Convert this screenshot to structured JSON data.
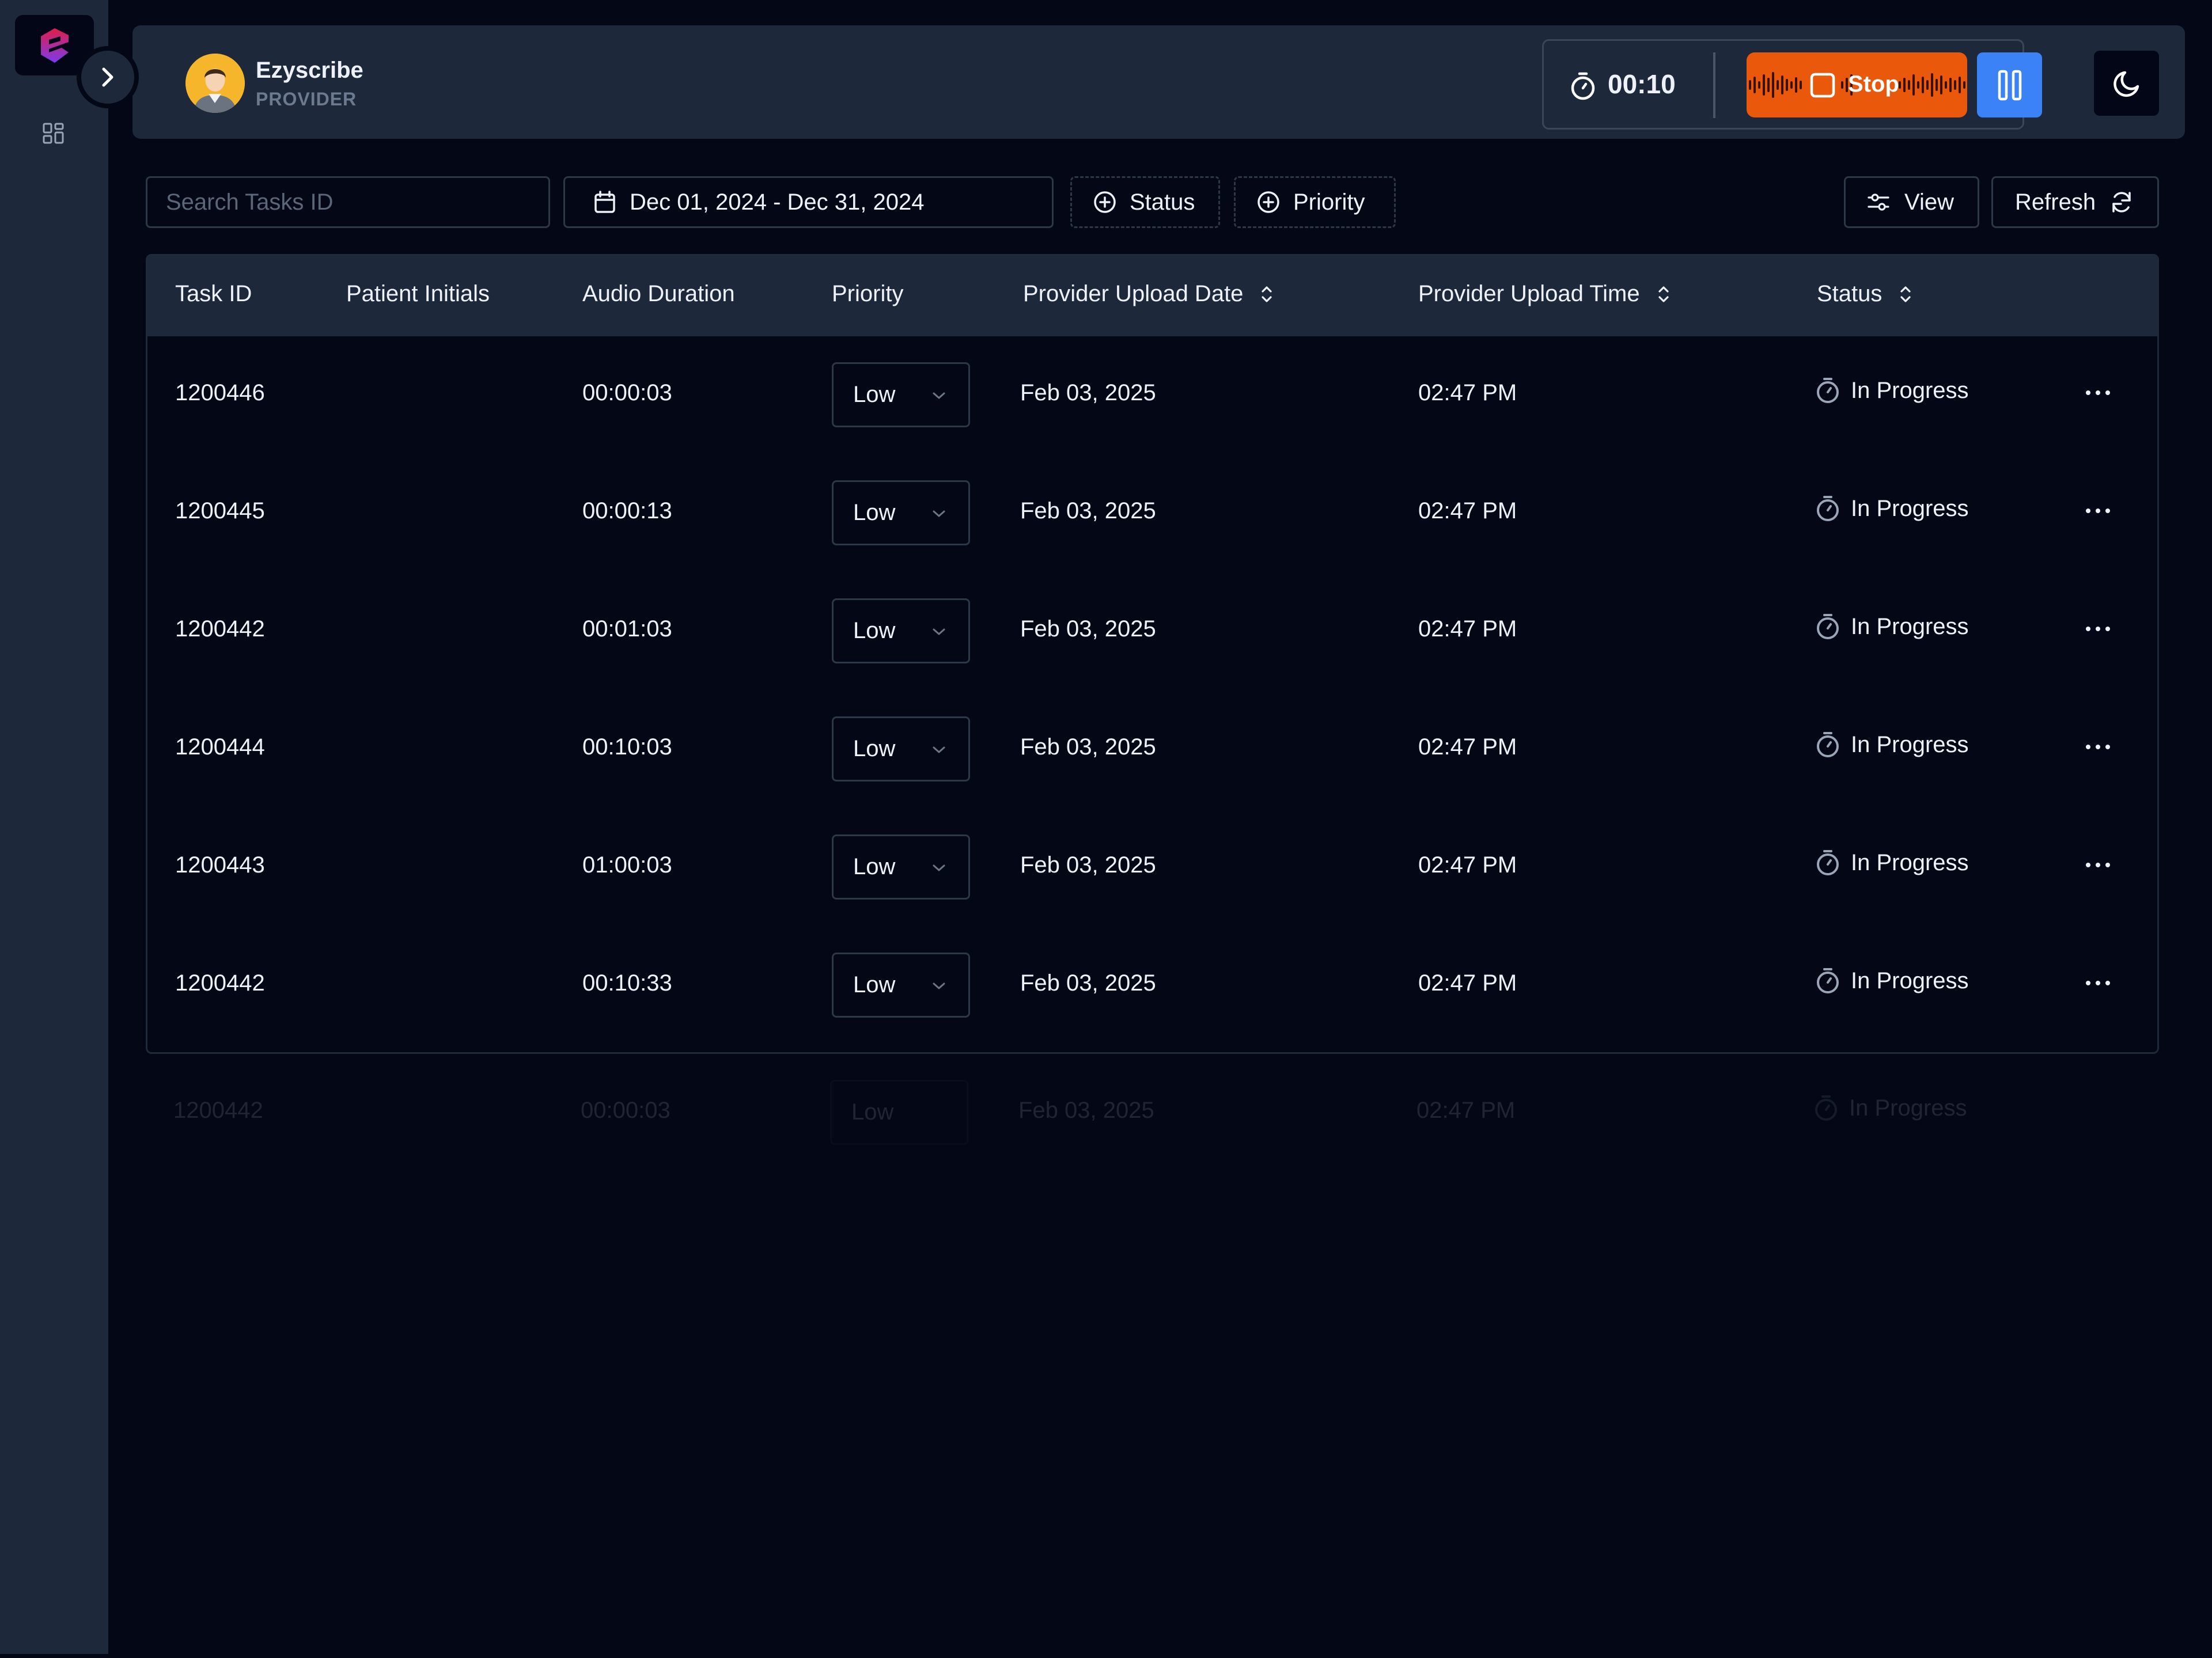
{
  "colors": {
    "background": "#040816",
    "panel": "#1d283a",
    "stop": "#ea580c",
    "pause": "#3b82f6",
    "avatar": "#f6b62b",
    "logo_accent": "#e11d48"
  },
  "header": {
    "brand_name": "Ezyscribe",
    "role": "PROVIDER",
    "timer": "00:10",
    "stop_label": "Stop"
  },
  "toolbar": {
    "search_placeholder": "Search Tasks ID",
    "date_range": "Dec 01, 2024 - Dec 31, 2024",
    "status_filter": "Status",
    "priority_filter": "Priority",
    "view_label": "View",
    "refresh_label": "Refresh"
  },
  "table": {
    "columns": [
      "Task ID",
      "Patient Initials",
      "Audio Duration",
      "Priority",
      "Provider Upload Date",
      "Provider Upload Time",
      "Status"
    ],
    "rows": [
      {
        "task_id": "1200446",
        "patient_initials": "",
        "duration": "00:00:03",
        "priority": "Low",
        "upload_date": "Feb 03, 2025",
        "upload_time": "02:47 PM",
        "status": "In Progress"
      },
      {
        "task_id": "1200445",
        "patient_initials": "",
        "duration": "00:00:13",
        "priority": "Low",
        "upload_date": "Feb 03, 2025",
        "upload_time": "02:47 PM",
        "status": "In Progress"
      },
      {
        "task_id": "1200442",
        "patient_initials": "",
        "duration": "00:01:03",
        "priority": "Low",
        "upload_date": "Feb 03, 2025",
        "upload_time": "02:47 PM",
        "status": "In Progress"
      },
      {
        "task_id": "1200444",
        "patient_initials": "",
        "duration": "00:10:03",
        "priority": "Low",
        "upload_date": "Feb 03, 2025",
        "upload_time": "02:47 PM",
        "status": "In Progress"
      },
      {
        "task_id": "1200443",
        "patient_initials": "",
        "duration": "01:00:03",
        "priority": "Low",
        "upload_date": "Feb 03, 2025",
        "upload_time": "02:47 PM",
        "status": "In Progress"
      },
      {
        "task_id": "1200442",
        "patient_initials": "",
        "duration": "00:10:33",
        "priority": "Low",
        "upload_date": "Feb 03, 2025",
        "upload_time": "02:47 PM",
        "status": "In Progress"
      }
    ],
    "ghost_row": {
      "task_id": "1200442",
      "duration": "00:00:03",
      "priority": "Low",
      "upload_date": "Feb 03, 2025",
      "upload_time": "02:47 PM",
      "status": "In Progress"
    }
  }
}
